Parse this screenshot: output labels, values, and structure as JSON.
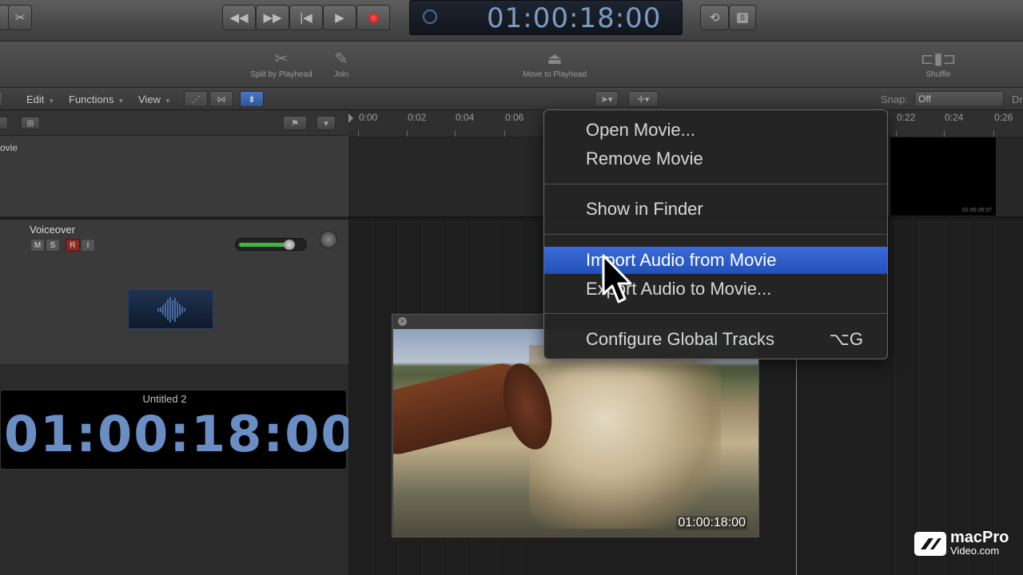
{
  "transport": {
    "time": "01:00:18:00"
  },
  "toolbar": {
    "split_label": "Split by Playhead",
    "join_label": "Join",
    "move_label": "Move to Playhead",
    "shuffle_label": "Shuffle"
  },
  "menubar": {
    "edit": "Edit",
    "functions": "Functions",
    "view": "View",
    "snap_label": "Snap:",
    "snap_value": "Off",
    "drag_partial": "Dr"
  },
  "tracks": {
    "movie_label_partial": "ovie",
    "voiceover_name": "Voiceover",
    "mute": "M",
    "solo": "S",
    "record": "R",
    "input": "I",
    "volume_level": 0.8
  },
  "ruler": {
    "ticks": [
      "0:00",
      "0:02",
      "0:04",
      "0:06",
      "0:22",
      "0:24",
      "0:26"
    ]
  },
  "movie_track": {
    "frame_timecode": "01:00:26:07"
  },
  "lcd": {
    "title": "Untitled 2",
    "time": "01:00:18:00"
  },
  "movie_window": {
    "timecode": "01:00:18:00"
  },
  "context_menu": {
    "items": [
      {
        "label": "Open Movie..."
      },
      {
        "label": "Remove Movie"
      },
      {
        "label": "Show in Finder"
      },
      {
        "label": "Import Audio from Movie"
      },
      {
        "label": "Export Audio to Movie..."
      },
      {
        "label": "Configure Global Tracks",
        "shortcut": "⌥G"
      }
    ]
  },
  "watermark": {
    "line1": "macPro",
    "line2": "Video.com"
  },
  "colors": {
    "accent_selection": "#2f5fcf",
    "lcd_text": "#7d9bc4",
    "record_red": "#d22"
  }
}
